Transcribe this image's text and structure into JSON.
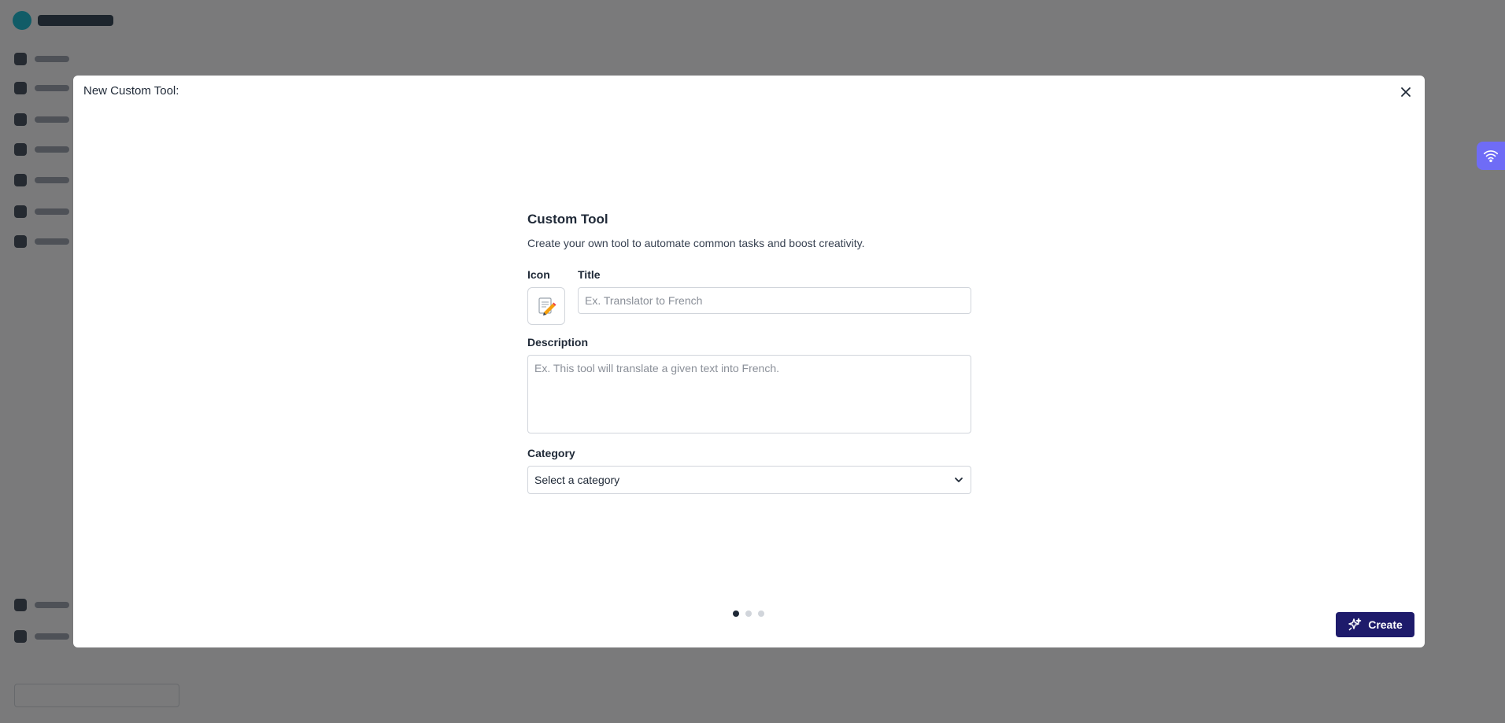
{
  "modal": {
    "title": "New Custom Tool:",
    "close_icon": "close-icon"
  },
  "form": {
    "heading": "Custom Tool",
    "subtitle": "Create your own tool to automate common tasks and boost creativity.",
    "icon_label": "Icon",
    "icon_glyph": "📝",
    "title_label": "Title",
    "title_placeholder": "Ex. Translator to French",
    "title_value": "",
    "description_label": "Description",
    "description_placeholder": "Ex. This tool will translate a given text into French.",
    "description_value": "",
    "category_label": "Category",
    "category_selected": "Select a category"
  },
  "stepper": {
    "steps": 3,
    "current": 1
  },
  "actions": {
    "create_label": "Create",
    "create_icon": "sparkle-icon"
  },
  "colors": {
    "primary_button": "#1e1b6b",
    "overlay": "rgba(0,0,0,0.5)",
    "floating_widget": "#6f6cf6"
  }
}
